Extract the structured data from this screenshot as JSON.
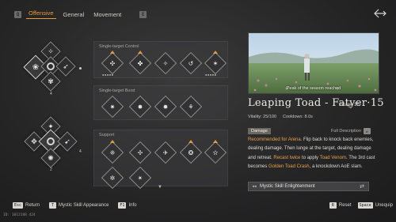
{
  "header": {
    "left_key": "Q",
    "tabs": [
      {
        "label": "Offensive",
        "active": true
      },
      {
        "label": "General",
        "active": false
      },
      {
        "label": "Movement",
        "active": false
      }
    ],
    "right_key": "E",
    "back_icon": "back-arrow-icon"
  },
  "skill_tree": {
    "top_cluster": {
      "level_a": "4",
      "level_b": "4"
    },
    "bottom_cluster": {
      "level_a": "2",
      "level_b": "4"
    }
  },
  "panels": [
    {
      "title": "Single-target Control"
    },
    {
      "title": "Single-target Burst"
    },
    {
      "title": "Support"
    }
  ],
  "detail": {
    "preview_caption": "Peak of the season reached",
    "skill_name": "Leaping Toad - Fatyer·15",
    "stage": "/Stage 15",
    "vitality": "Vitality: 25/100",
    "cooldown": "Cooldown: 8.0s",
    "tag": "Damage",
    "full_description": "Full Description",
    "desc_parts": [
      {
        "t": "Recommended for Arena.",
        "hl": true
      },
      {
        "t": " Flip back to knock back enemies, dealing damage. Then lunge at the target, dealing damage and retreat. ",
        "hl": false
      },
      {
        "t": "Recast twice",
        "hl": true
      },
      {
        "t": " to apply ",
        "hl": false
      },
      {
        "t": "Toad Venom",
        "hl": true
      },
      {
        "t": ". The 3rd cast becomes ",
        "hl": false
      },
      {
        "t": "Golden Toad Crash",
        "hl": true
      },
      {
        "t": ", a knockdown AoE slam.",
        "hl": false
      }
    ],
    "enlightenment": "Mystic Skill Enlightenment"
  },
  "bottom": {
    "return_key": "Esc",
    "return_label": "Return",
    "appearance_key": "T",
    "appearance_label": "Mystic Skill Appearance",
    "info_key": "F1",
    "info_label": "Info",
    "reset_key": "R",
    "reset_label": "Reset",
    "unequip_key": "Space",
    "unequip_label": "Unequip"
  },
  "uid": "ID: 1812188 424"
}
